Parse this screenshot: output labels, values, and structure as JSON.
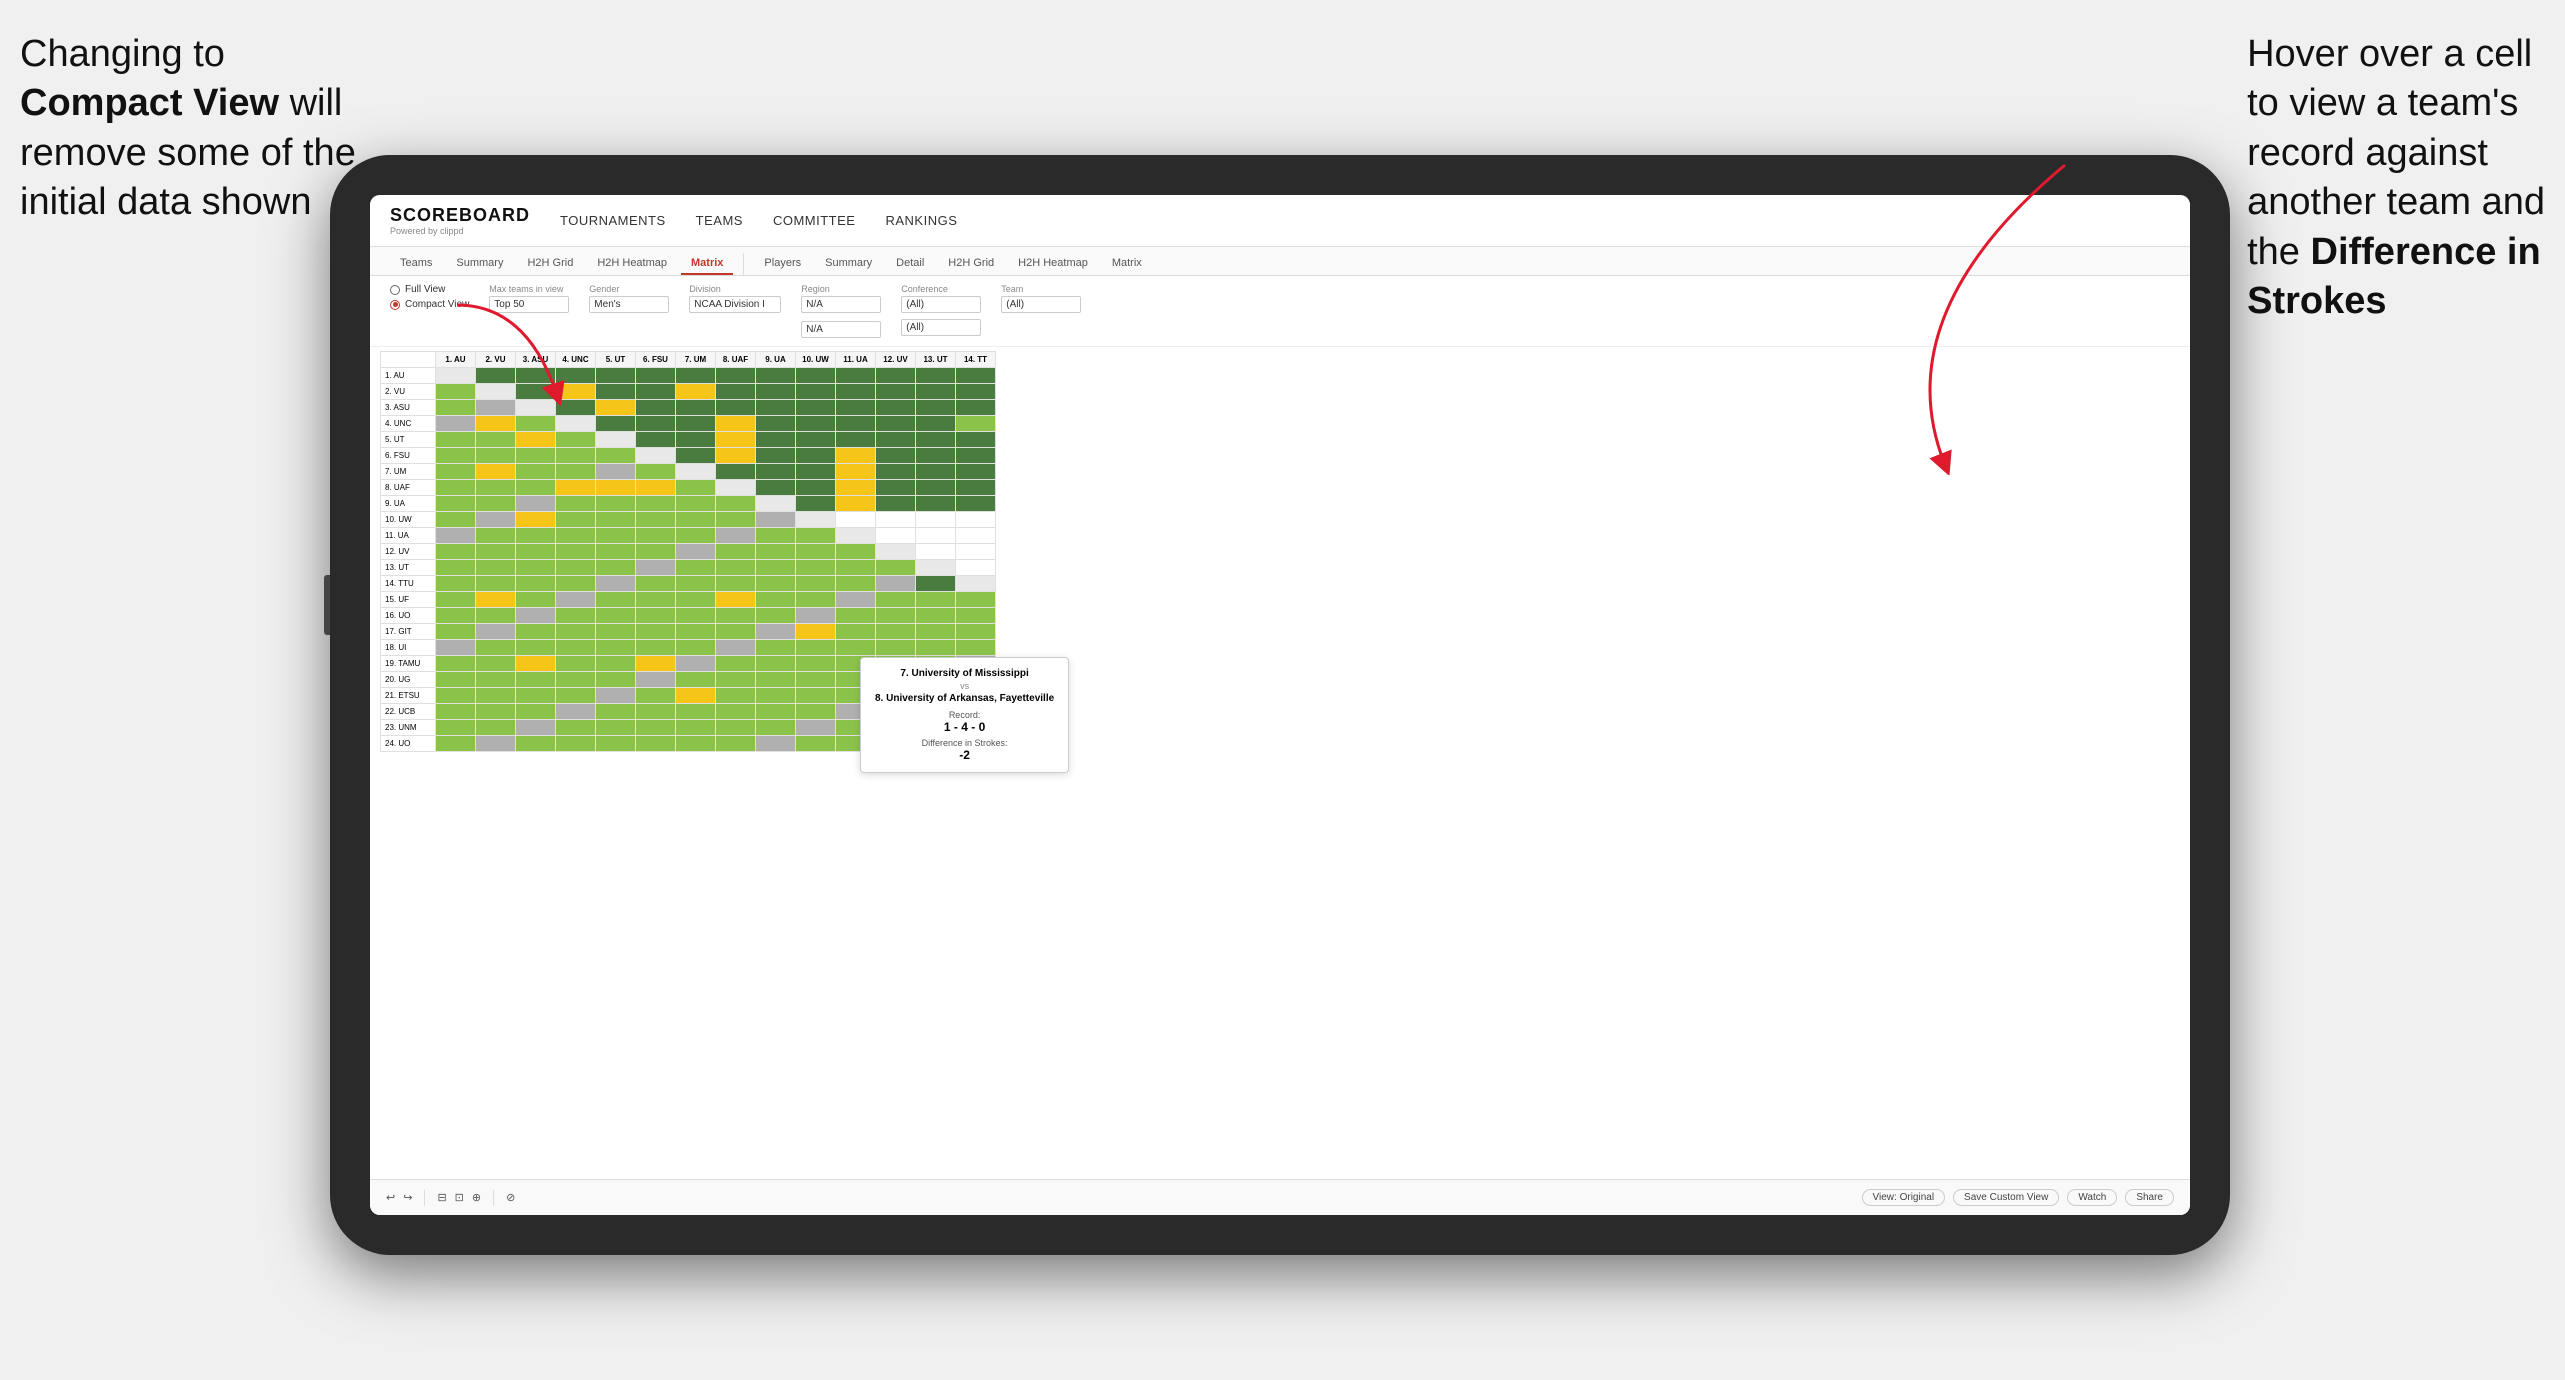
{
  "annotations": {
    "left": {
      "line1": "Changing to",
      "line2_bold": "Compact View",
      "line2_rest": " will",
      "line3": "remove some of the",
      "line4": "initial data shown"
    },
    "right": {
      "line1": "Hover over a cell",
      "line2": "to view a team's",
      "line3": "record against",
      "line4": "another team and",
      "line5_pre": "the ",
      "line5_bold": "Difference in",
      "line6_bold": "Strokes"
    }
  },
  "app": {
    "logo": "SCOREBOARD",
    "logo_sub": "Powered by clippd",
    "nav": [
      "TOURNAMENTS",
      "TEAMS",
      "COMMITTEE",
      "RANKINGS"
    ],
    "subnav_groups": [
      [
        "Teams",
        "Summary",
        "H2H Grid",
        "H2H Heatmap",
        "Matrix"
      ],
      [
        "Players",
        "Summary",
        "Detail",
        "H2H Grid",
        "H2H Heatmap",
        "Matrix"
      ]
    ],
    "active_subnav": "Matrix"
  },
  "controls": {
    "view_label": "Full View",
    "view_label2": "Compact View",
    "view_selected": "compact",
    "filters": [
      {
        "label": "Max teams in view",
        "value": "Top 50"
      },
      {
        "label": "Gender",
        "value": "Men's"
      },
      {
        "label": "Division",
        "value": "NCAA Division I"
      },
      {
        "label": "Region",
        "value": "N/A"
      },
      {
        "label": "Conference",
        "value": "(All)"
      },
      {
        "label": "Team",
        "value": "(All)"
      }
    ]
  },
  "matrix": {
    "col_headers": [
      "1. AU",
      "2. VU",
      "3. ASU",
      "4. UNC",
      "5. UT",
      "6. FSU",
      "7. UM",
      "8. UAF",
      "9. UA",
      "10. UW",
      "11. UA",
      "12. UV",
      "13. UT",
      "14. TT"
    ],
    "rows": [
      {
        "label": "1. AU",
        "cells": [
          "D",
          "G",
          "G",
          "G",
          "G",
          "G",
          "G",
          "G",
          "G",
          "G",
          "G",
          "G",
          "G",
          "G"
        ]
      },
      {
        "label": "2. VU",
        "cells": [
          "",
          "D",
          "G",
          "Y",
          "G",
          "G",
          "Y",
          "G",
          "G",
          "G",
          "G",
          "G",
          "G",
          "G"
        ]
      },
      {
        "label": "3. ASU",
        "cells": [
          "",
          "",
          "D",
          "G",
          "Y",
          "G",
          "G",
          "G",
          "G",
          "G",
          "W",
          "G",
          "G",
          "G"
        ]
      },
      {
        "label": "4. UNC",
        "cells": [
          "",
          "",
          "",
          "D",
          "G",
          "G",
          "G",
          "Y",
          "G",
          "G",
          "G",
          "G",
          "G",
          "W"
        ]
      },
      {
        "label": "5. UT",
        "cells": [
          "",
          "",
          "",
          "",
          "D",
          "G",
          "G",
          "Y",
          "G",
          "G",
          "G",
          "G",
          "G",
          "G"
        ]
      },
      {
        "label": "6. FSU",
        "cells": [
          "",
          "",
          "",
          "",
          "",
          "D",
          "G",
          "Y",
          "G",
          "G",
          "Y",
          "G",
          "G",
          "G"
        ]
      },
      {
        "label": "7. UM",
        "cells": [
          "",
          "",
          "",
          "",
          "",
          "",
          "D",
          "G",
          "G",
          "G",
          "G",
          "G",
          "G",
          "G"
        ]
      },
      {
        "label": "8. UAF",
        "cells": [
          "",
          "",
          "",
          "",
          "",
          "",
          "",
          "D",
          "G",
          "G",
          "G",
          "G",
          "G",
          "G"
        ]
      },
      {
        "label": "9. UA",
        "cells": [
          "",
          "",
          "",
          "",
          "",
          "",
          "",
          "",
          "D",
          "G",
          "G",
          "G",
          "G",
          "G"
        ]
      },
      {
        "label": "10. UW",
        "cells": [
          "W",
          "W",
          "Y",
          "W",
          "W",
          "W",
          "W",
          "W",
          "D",
          "",
          "",
          "",
          "",
          ""
        ]
      },
      {
        "label": "11. UA",
        "cells": [
          "W",
          "W",
          "W",
          "W",
          "W",
          "W",
          "W",
          "W",
          "W",
          "D",
          "",
          "",
          "",
          ""
        ]
      },
      {
        "label": "12. UV",
        "cells": [
          "W",
          "W",
          "W",
          "W",
          "W",
          "W",
          "W",
          "W",
          "W",
          "W",
          "D",
          "",
          "",
          ""
        ]
      },
      {
        "label": "13. UT",
        "cells": [
          "W",
          "W",
          "W",
          "W",
          "W",
          "W",
          "W",
          "W",
          "W",
          "W",
          "W",
          "D",
          "",
          ""
        ]
      },
      {
        "label": "14. TTU",
        "cells": [
          "W",
          "W",
          "W",
          "W",
          "W",
          "W",
          "W",
          "W",
          "W",
          "W",
          "W",
          "W",
          "D",
          ""
        ]
      },
      {
        "label": "15. UF",
        "cells": [
          "W",
          "W",
          "W",
          "W",
          "W",
          "W",
          "W",
          "W",
          "W",
          "W",
          "W",
          "W",
          "W",
          "D"
        ]
      },
      {
        "label": "16. UO",
        "cells": [
          "W",
          "W",
          "W",
          "W",
          "W",
          "W",
          "W",
          "W",
          "W",
          "W",
          "W",
          "W",
          "W",
          "W"
        ]
      },
      {
        "label": "17. GIT",
        "cells": [
          "W",
          "W",
          "W",
          "W",
          "W",
          "W",
          "W",
          "W",
          "W",
          "W",
          "W",
          "W",
          "W",
          "W"
        ]
      },
      {
        "label": "18. UI",
        "cells": [
          "W",
          "W",
          "W",
          "W",
          "W",
          "W",
          "W",
          "W",
          "W",
          "W",
          "W",
          "W",
          "W",
          "W"
        ]
      },
      {
        "label": "19. TAMU",
        "cells": [
          "W",
          "W",
          "W",
          "W",
          "W",
          "W",
          "W",
          "W",
          "W",
          "W",
          "W",
          "W",
          "W",
          "W"
        ]
      },
      {
        "label": "20. UG",
        "cells": [
          "W",
          "W",
          "W",
          "W",
          "W",
          "W",
          "W",
          "W",
          "W",
          "W",
          "W",
          "W",
          "W",
          "W"
        ]
      },
      {
        "label": "21. ETSU",
        "cells": [
          "W",
          "W",
          "W",
          "W",
          "W",
          "W",
          "W",
          "W",
          "W",
          "W",
          "W",
          "W",
          "W",
          "W"
        ]
      },
      {
        "label": "22. UCB",
        "cells": [
          "W",
          "W",
          "W",
          "W",
          "W",
          "W",
          "W",
          "W",
          "W",
          "W",
          "W",
          "W",
          "W",
          "W"
        ]
      },
      {
        "label": "23. UNM",
        "cells": [
          "W",
          "W",
          "W",
          "W",
          "W",
          "W",
          "W",
          "W",
          "W",
          "W",
          "W",
          "W",
          "W",
          "W"
        ]
      },
      {
        "label": "24. UO",
        "cells": [
          "W",
          "W",
          "W",
          "W",
          "W",
          "W",
          "W",
          "W",
          "W",
          "W",
          "W",
          "W",
          "W",
          "W"
        ]
      }
    ]
  },
  "tooltip": {
    "team1": "7. University of Mississippi",
    "vs": "vs",
    "team2": "8. University of Arkansas, Fayetteville",
    "record_label": "Record:",
    "record": "1 - 4 - 0",
    "diff_label": "Difference in Strokes:",
    "diff": "-2"
  },
  "toolbar": {
    "buttons": [
      "↩",
      "↪",
      "⟳",
      "⊡",
      "⊟",
      "⊕",
      "⊘"
    ],
    "view_original": "View: Original",
    "save_custom": "Save Custom View",
    "watch": "Watch",
    "share": "Share"
  }
}
